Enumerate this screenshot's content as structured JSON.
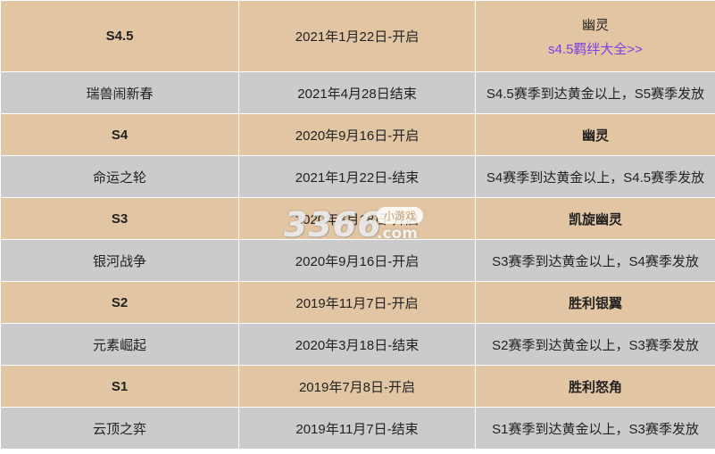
{
  "rows": [
    {
      "type": "season",
      "name": "S4.5",
      "date": "2021年1月22日-开启",
      "reward": "幽灵",
      "link": "s4.5羁绊大全>>"
    },
    {
      "type": "event",
      "name": "瑞兽闹新春",
      "date": "2021年4月28日结束",
      "reward": "S4.5赛季到达黄金以上，S5赛季发放"
    },
    {
      "type": "season",
      "name": "S4",
      "date": "2020年9月16日-开启",
      "reward": "幽灵"
    },
    {
      "type": "event",
      "name": "命运之轮",
      "date": "2021年1月22日-结束",
      "reward": "S4赛季到达黄金以上，S4.5赛季发放"
    },
    {
      "type": "season",
      "name": "S3",
      "date": "2020年3月18日-开启",
      "reward": "凯旋幽灵"
    },
    {
      "type": "event",
      "name": "银河战争",
      "date": "2020年9月16日-开启",
      "reward": "S3赛季到达黄金以上，S4赛季发放"
    },
    {
      "type": "season",
      "name": "S2",
      "date": "2019年11月7日-开启",
      "reward": "胜利银翼"
    },
    {
      "type": "event",
      "name": "元素崛起",
      "date": "2020年3月18日-结束",
      "reward": "S2赛季到达黄金以上，S3赛季发放"
    },
    {
      "type": "season",
      "name": "S1",
      "date": "2019年7月8日-开启",
      "reward": "胜利怒角"
    },
    {
      "type": "event",
      "name": "云顶之弈",
      "date": "2019年11月7日-结束",
      "reward": "S1赛季到达黄金以上，S3赛季发放"
    }
  ],
  "watermark": {
    "digits": "3366",
    "badge": "小游戏",
    "domain": ".com"
  },
  "colors": {
    "season_bg": "#e2c5a3",
    "event_bg": "#cbcbcb",
    "link": "#7b3fe4"
  }
}
